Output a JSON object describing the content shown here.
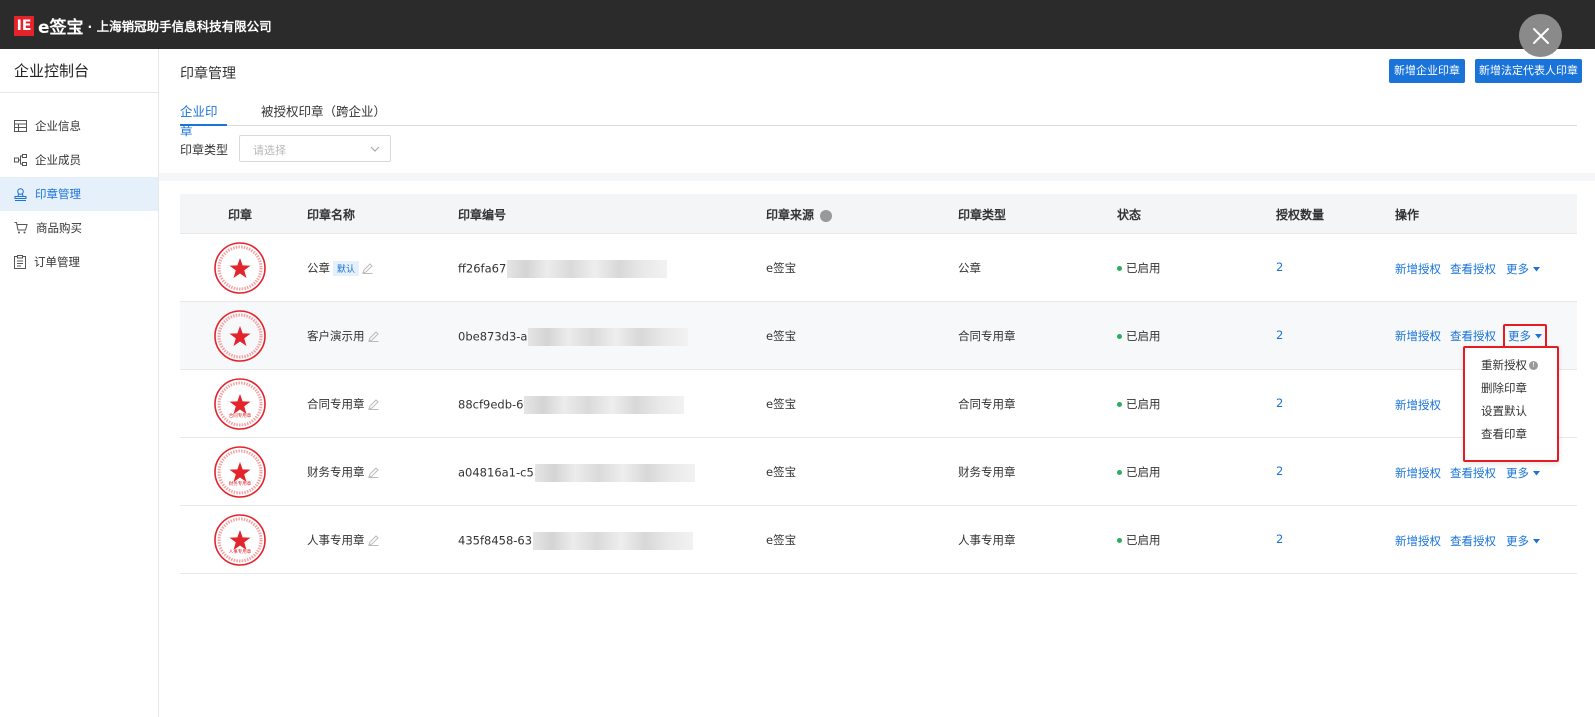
{
  "header": {
    "brand": "e签宝",
    "company": "· 上海销冠助手信息科技有限公司"
  },
  "sidebar": {
    "title": "企业控制台",
    "items": [
      {
        "label": "企业信息",
        "icon": "table-icon",
        "active": false
      },
      {
        "label": "企业成员",
        "icon": "org-chart-icon",
        "active": false
      },
      {
        "label": "印章管理",
        "icon": "stamp-icon",
        "active": true
      },
      {
        "label": "商品购买",
        "icon": "cart-icon",
        "active": false
      },
      {
        "label": "订单管理",
        "icon": "clipboard-icon",
        "active": false
      }
    ]
  },
  "page": {
    "title": "印章管理",
    "add_company_seal": "新增企业印章",
    "add_legal_seal": "新增法定代表人印章"
  },
  "tabs": [
    {
      "label": "企业印章",
      "active": true
    },
    {
      "label": "被授权印章（跨企业）",
      "active": false
    }
  ],
  "filter": {
    "label": "印章类型",
    "placeholder": "请选择"
  },
  "table": {
    "columns": [
      "印章",
      "印章名称",
      "印章编号",
      "印章来源",
      "印章类型",
      "状态",
      "授权数量",
      "操作"
    ],
    "rows": [
      {
        "name": "公章",
        "badge": "默认",
        "id_prefix": "ff26fa67",
        "source": "e签宝",
        "type": "公章",
        "status": "已启用",
        "count": "2",
        "seal_text": ""
      },
      {
        "name": "客户演示用",
        "badge": "",
        "id_prefix": "0be873d3-a",
        "source": "e签宝",
        "type": "合同专用章",
        "status": "已启用",
        "count": "2",
        "seal_text": ""
      },
      {
        "name": "合同专用章",
        "badge": "",
        "id_prefix": "88cf9edb-6",
        "source": "e签宝",
        "type": "合同专用章",
        "status": "已启用",
        "count": "2",
        "seal_text": "合同专用章"
      },
      {
        "name": "财务专用章",
        "badge": "",
        "id_prefix": "a04816a1-c5",
        "source": "e签宝",
        "type": "财务专用章",
        "status": "已启用",
        "count": "2",
        "seal_text": "财务专用章"
      },
      {
        "name": "人事专用章",
        "badge": "",
        "id_prefix": "435f8458-63",
        "source": "e签宝",
        "type": "人事专用章",
        "status": "已启用",
        "count": "2",
        "seal_text": "人事专用章"
      }
    ],
    "actions": {
      "add_auth": "新增授权",
      "view_auth": "查看授权",
      "more": "更多"
    }
  },
  "dropdown": {
    "items": [
      "重新授权",
      "删除印章",
      "设置默认",
      "查看印章"
    ],
    "info_glyph": "!"
  },
  "colors": {
    "accent": "#1a73d9",
    "seal_red": "#e3242b",
    "highlight": "#e51c23",
    "status_green": "#27ae60"
  }
}
